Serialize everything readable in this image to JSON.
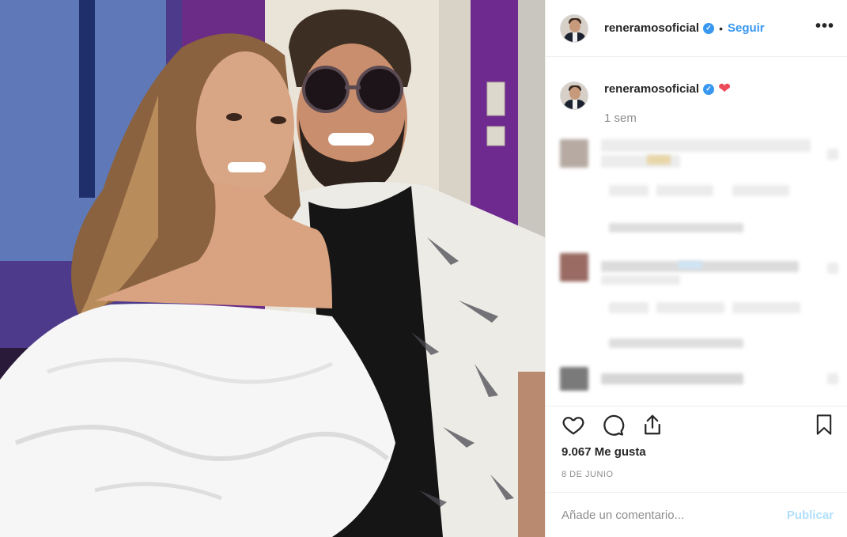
{
  "post": {
    "username": "reneramosoficial",
    "verified_mark": "✓",
    "separator": "•",
    "follow_label": "Seguir",
    "more_label": "•••",
    "caption_emoji": "❤",
    "time_ago": "1 sem",
    "likes": "9.067 Me gusta",
    "date": "8 DE JUNIO"
  },
  "comment_box": {
    "placeholder": "Añade un comentario...",
    "publish_label": "Publicar"
  },
  "icons": [
    "heart-icon",
    "comment-icon",
    "share-icon",
    "bookmark-icon",
    "verified-icon",
    "more-icon"
  ],
  "colors": {
    "accent": "#3897f0",
    "heart": "#ed4956",
    "muted": "#8e8e8e",
    "publish_disabled": "#b2dffc"
  }
}
